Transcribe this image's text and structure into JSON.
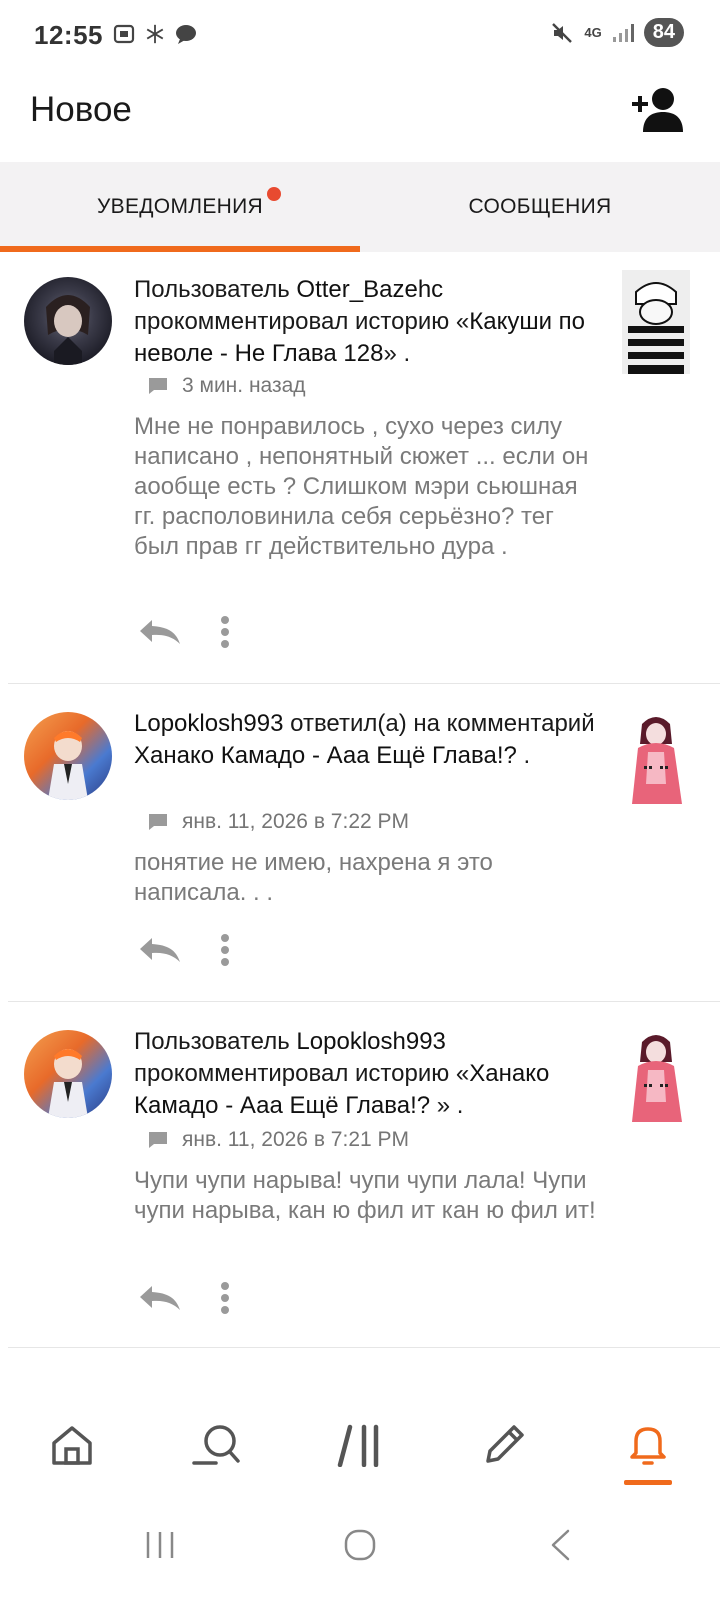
{
  "status": {
    "time": "12:55",
    "battery": "84",
    "network": "4G"
  },
  "header": {
    "title": "Новое"
  },
  "tabs": [
    {
      "label": "УВЕДОМЛЕНИЯ",
      "active": true,
      "has_dot": true
    },
    {
      "label": "СООБЩЕНИЯ",
      "active": false
    }
  ],
  "notifications": [
    {
      "pre": "Пользователь ",
      "user": "Otter_Bazehc",
      "mid": " прокомментировал историю «",
      "target": "Какуши по неволе - Не Глава 128",
      "post": "» .",
      "time": "3 мин. назад",
      "body": "Мне не понравилось , сухо через силу написано , непонятный сюжет ... если он аообще есть ? Слишком мэри сьюшная гг. располовинила себя серьёзно? тег был прав гг действительно дура ."
    },
    {
      "pre": "",
      "user": "Lopoklosh993",
      "mid": " ответил(а) на комментарий ",
      "target": "Ханако Камадо - Ааа Ещё Глава!?",
      "post": " .",
      "time": "янв. 11, 2026 в 7:22 PM",
      "body": "понятие не имею, нахрена я это написала. . ."
    },
    {
      "pre": "Пользователь ",
      "user": "Lopoklosh993",
      "mid": " прокомментировал историю «",
      "target": "Ханако Камадо - Ааа Ещё Глава!?",
      "post": " » .",
      "time": "янв. 11, 2026 в 7:21 PM",
      "body": "Чупи чупи нарыва! чупи чупи лала! Чупи чупи нарыва, кан ю фил ит кан ю фил ит!"
    }
  ],
  "colors": {
    "accent": "#f06a1c",
    "dot": "#e84a30",
    "tabs_bg": "#f3f2f3",
    "muted": "#7a7a7a"
  },
  "bottom_nav": [
    "home-icon",
    "search-icon",
    "library-icon",
    "write-icon",
    "bell-icon"
  ]
}
